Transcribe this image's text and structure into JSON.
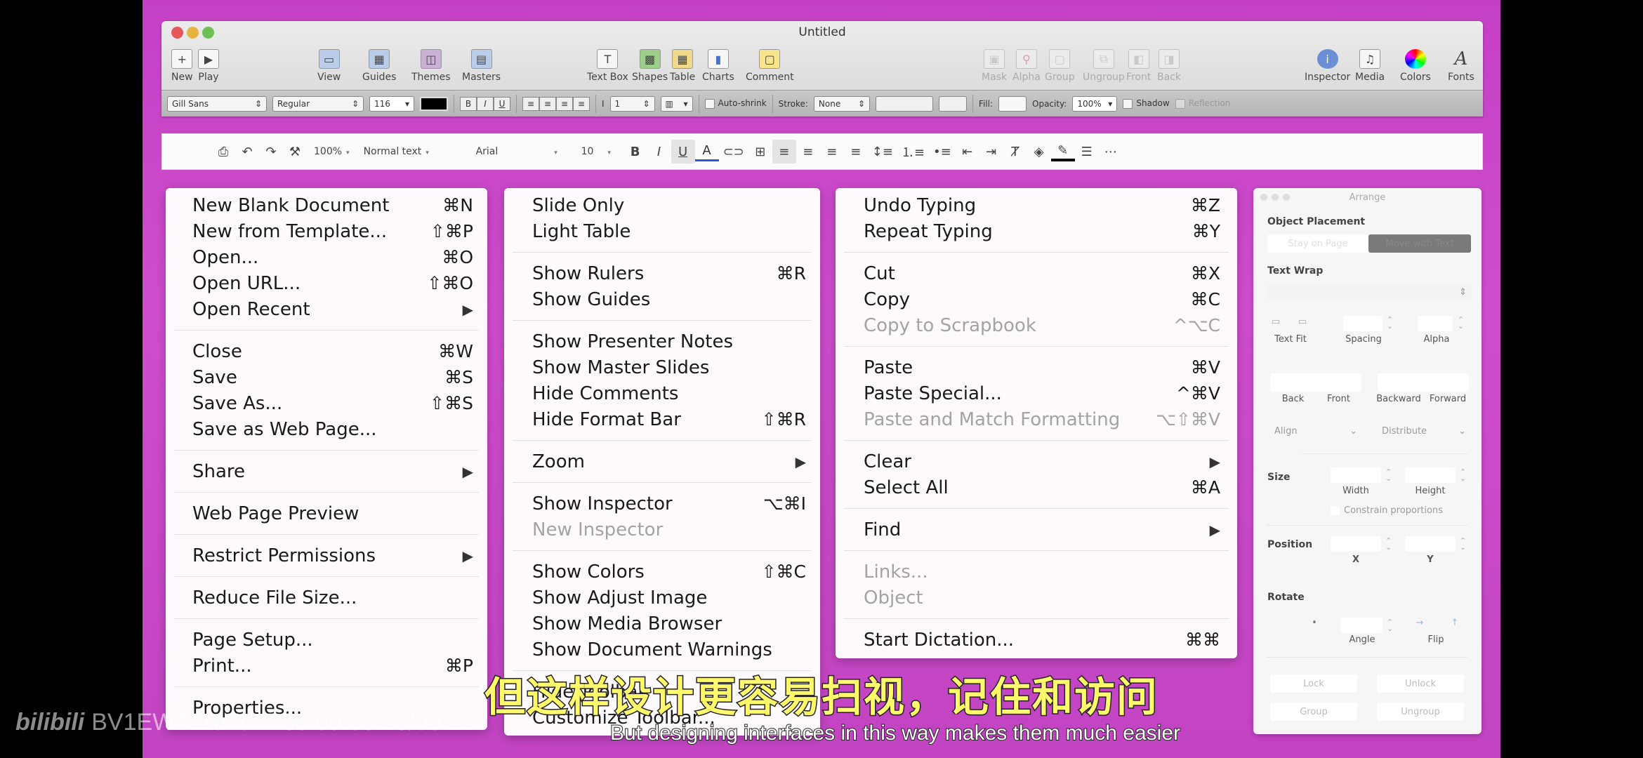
{
  "window": {
    "title": "Untitled",
    "toolbar_left": [
      {
        "name": "new",
        "label": "New",
        "icon": "+"
      },
      {
        "name": "play",
        "label": "Play",
        "icon": "▶"
      }
    ],
    "toolbar_view": [
      {
        "name": "view",
        "label": "View",
        "icon": "▭"
      },
      {
        "name": "guides",
        "label": "Guides",
        "icon": "▦"
      },
      {
        "name": "themes",
        "label": "Themes",
        "icon": "◫"
      },
      {
        "name": "masters",
        "label": "Masters",
        "icon": "▤"
      }
    ],
    "toolbar_insert": [
      {
        "name": "text-box",
        "label": "Text Box",
        "icon": "T"
      },
      {
        "name": "shapes",
        "label": "Shapes",
        "icon": "▩"
      },
      {
        "name": "table",
        "label": "Table",
        "icon": "▦"
      },
      {
        "name": "charts",
        "label": "Charts",
        "icon": "▮"
      },
      {
        "name": "comment",
        "label": "Comment",
        "icon": "▢"
      }
    ],
    "toolbar_arrange": [
      {
        "name": "mask",
        "label": "Mask",
        "icon": "▣"
      },
      {
        "name": "alpha",
        "label": "Alpha",
        "icon": "⚲"
      },
      {
        "name": "group",
        "label": "Group",
        "icon": "▢"
      },
      {
        "name": "ungroup",
        "label": "Ungroup",
        "icon": "⧉"
      },
      {
        "name": "front",
        "label": "Front",
        "icon": "◧"
      },
      {
        "name": "back",
        "label": "Back",
        "icon": "◨"
      }
    ],
    "toolbar_right": [
      {
        "name": "inspector",
        "label": "Inspector",
        "icon": "i"
      },
      {
        "name": "media",
        "label": "Media",
        "icon": "♫"
      },
      {
        "name": "colors",
        "label": "Colors",
        "icon": "●"
      },
      {
        "name": "fonts",
        "label": "Fonts",
        "icon": "A"
      }
    ],
    "format_bar": {
      "font_family": "Gill Sans",
      "font_style": "Regular",
      "font_size": "116",
      "bold": "B",
      "italic": "I",
      "underline": "U",
      "line_spacing": "1",
      "auto_shrink": "Auto-shrink",
      "stroke_label": "Stroke:",
      "stroke_value": "None",
      "fill_label": "Fill:",
      "opacity_label": "Opacity:",
      "opacity_value": "100%",
      "shadow": "Shadow",
      "reflection": "Reflection"
    }
  },
  "docs_toolbar": {
    "zoom": "100%",
    "style": "Normal text",
    "font": "Arial",
    "size": "10",
    "bold": "B",
    "italic": "I",
    "underline": "U",
    "text_color": "A"
  },
  "menus": {
    "file": {
      "groups": [
        [
          {
            "label": "New Blank Document",
            "shortcut": "⌘N"
          },
          {
            "label": "New from Template...",
            "shortcut": "⇧⌘P"
          },
          {
            "label": "Open...",
            "shortcut": "⌘O"
          },
          {
            "label": "Open URL...",
            "shortcut": "⇧⌘O"
          },
          {
            "label": "Open Recent",
            "submenu": true
          }
        ],
        [
          {
            "label": "Close",
            "shortcut": "⌘W"
          },
          {
            "label": "Save",
            "shortcut": "⌘S"
          },
          {
            "label": "Save As...",
            "shortcut": "⇧⌘S"
          },
          {
            "label": "Save as Web Page..."
          }
        ],
        [
          {
            "label": "Share",
            "submenu": true
          }
        ],
        [
          {
            "label": "Web Page Preview"
          }
        ],
        [
          {
            "label": "Restrict Permissions",
            "submenu": true
          }
        ],
        [
          {
            "label": "Reduce File Size..."
          }
        ],
        [
          {
            "label": "Page Setup..."
          },
          {
            "label": "Print...",
            "shortcut": "⌘P"
          }
        ],
        [
          {
            "label": "Properties..."
          }
        ]
      ]
    },
    "view": {
      "groups": [
        [
          {
            "label": "Slide Only"
          },
          {
            "label": "Light Table"
          }
        ],
        [
          {
            "label": "Show Rulers",
            "shortcut": "⌘R"
          },
          {
            "label": "Show Guides"
          }
        ],
        [
          {
            "label": "Show Presenter Notes"
          },
          {
            "label": "Show Master Slides"
          },
          {
            "label": "Hide Comments"
          },
          {
            "label": "Hide Format Bar",
            "shortcut": "⇧⌘R"
          }
        ],
        [
          {
            "label": "Zoom",
            "submenu": true
          }
        ],
        [
          {
            "label": "Show Inspector",
            "shortcut": "⌥⌘I"
          },
          {
            "label": "New Inspector",
            "disabled": true
          }
        ],
        [
          {
            "label": "Show Colors",
            "shortcut": "⇧⌘C"
          },
          {
            "label": "Show Adjust Image"
          },
          {
            "label": "Show Media Browser"
          },
          {
            "label": "Show Document Warnings"
          }
        ],
        [
          {
            "label": "Hide Toolbar"
          },
          {
            "label": "Customize Toolbar..."
          }
        ]
      ]
    },
    "edit": {
      "groups": [
        [
          {
            "label": "Undo Typing",
            "shortcut": "⌘Z"
          },
          {
            "label": "Repeat Typing",
            "shortcut": "⌘Y"
          }
        ],
        [
          {
            "label": "Cut",
            "shortcut": "⌘X"
          },
          {
            "label": "Copy",
            "shortcut": "⌘C"
          },
          {
            "label": "Copy to Scrapbook",
            "shortcut": "^⌥C",
            "disabled": true
          }
        ],
        [
          {
            "label": "Paste",
            "shortcut": "⌘V"
          },
          {
            "label": "Paste Special...",
            "shortcut": "^⌘V"
          },
          {
            "label": "Paste and Match Formatting",
            "shortcut": "⌥⇧⌘V",
            "disabled": true
          }
        ],
        [
          {
            "label": "Clear",
            "submenu": true
          },
          {
            "label": "Select All",
            "shortcut": "⌘A"
          }
        ],
        [
          {
            "label": "Find",
            "submenu": true
          }
        ],
        [
          {
            "label": "Links...",
            "disabled": true
          },
          {
            "label": "Object",
            "disabled": true
          }
        ],
        [
          {
            "label": "Start Dictation...",
            "shortcut": "⌘⌘"
          }
        ]
      ]
    }
  },
  "arrange_panel": {
    "title": "Arrange",
    "object_placement": "Object Placement",
    "placement_options": [
      "Stay on Page",
      "Move with Text"
    ],
    "text_wrap": "Text Wrap",
    "text_fit": "Text Fit",
    "spacing": "Spacing",
    "alpha": "Alpha",
    "back": "Back",
    "front": "Front",
    "backward": "Backward",
    "forward": "Forward",
    "align": "Align",
    "distribute": "Distribute",
    "size": "Size",
    "width": "Width",
    "height": "Height",
    "constrain": "Constrain proportions",
    "position": "Position",
    "x": "X",
    "y": "Y",
    "rotate": "Rotate",
    "angle": "Angle",
    "flip": "Flip",
    "lock": "Lock",
    "unlock": "Unlock",
    "group": "Group",
    "ungroup": "Ungroup"
  },
  "overlay": {
    "subtitle_cn": "但这样设计更容易扫视，记住和访问",
    "subtitle_en": "But designing interfaces in this way makes them much easier",
    "watermark_logo": "bilibili",
    "watermark_id": "BV1EW411u7th P38 00:03:23/00:12"
  }
}
